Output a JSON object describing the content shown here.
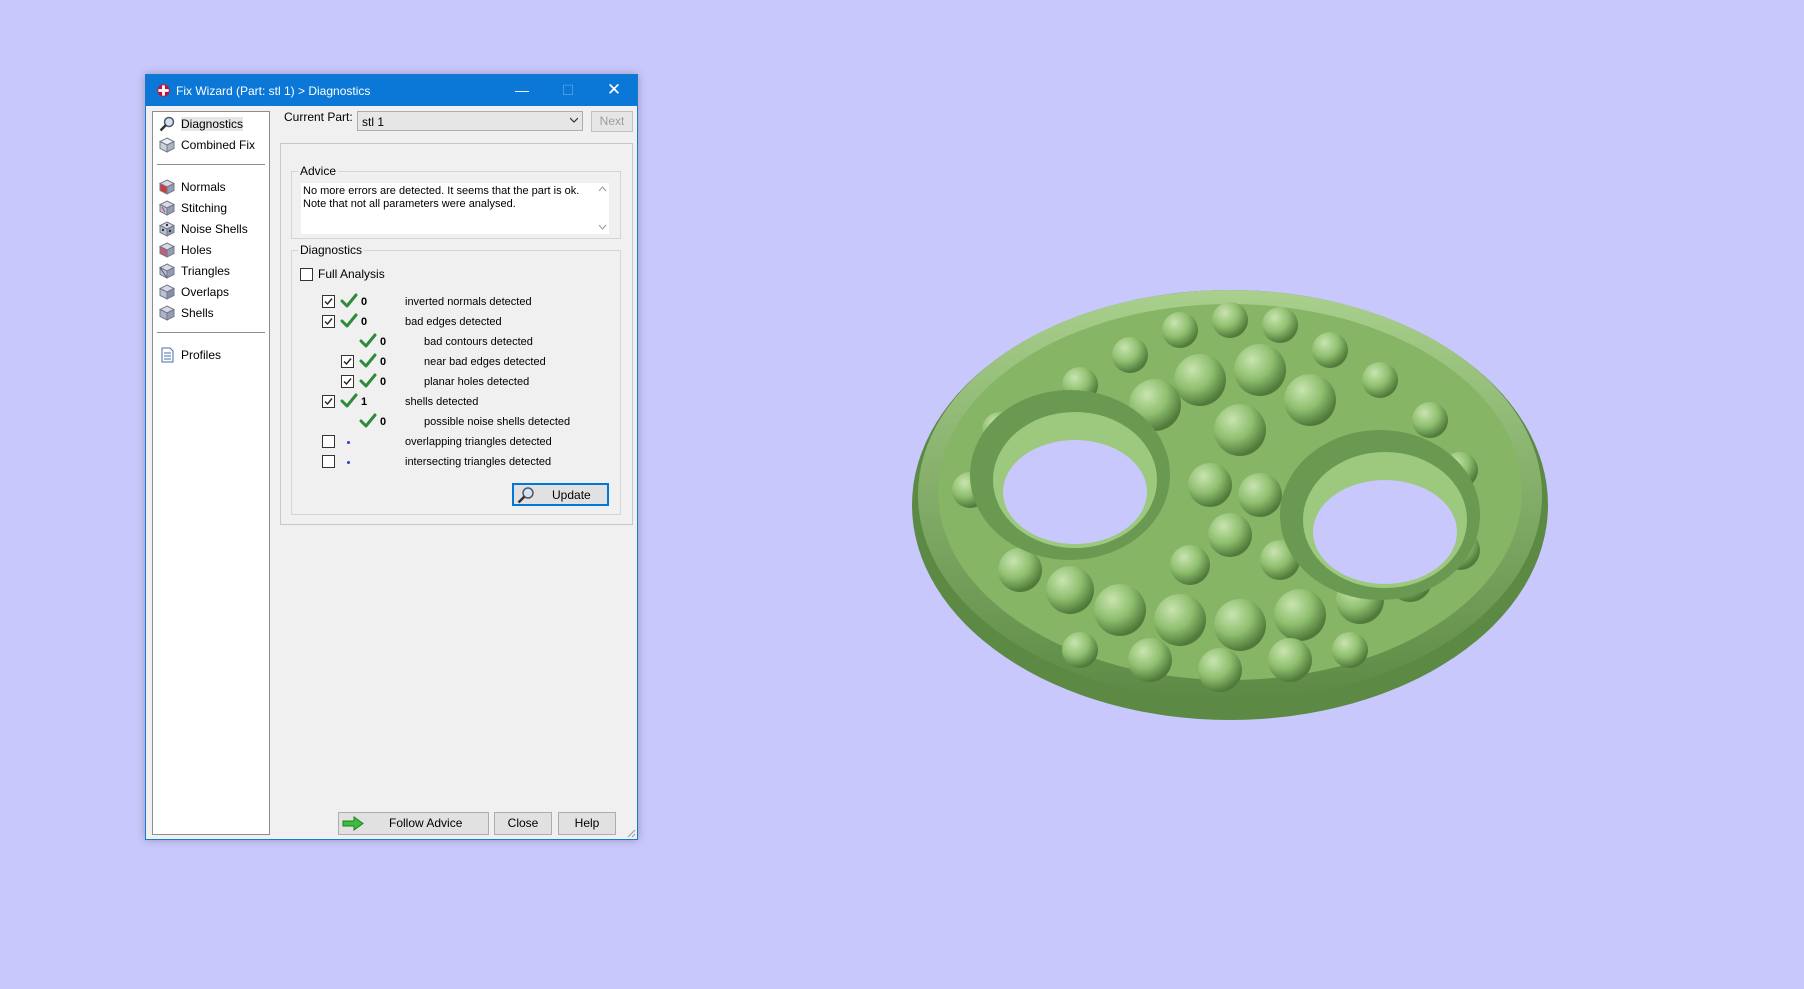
{
  "window": {
    "title": "Fix Wizard (Part: stl 1) > Diagnostics",
    "minimize_glyph": "—",
    "maximize_glyph": "☐",
    "close_glyph": "✕"
  },
  "sidebar": {
    "items": [
      {
        "label": "Diagnostics",
        "icon": "magnifier-icon",
        "selected": true
      },
      {
        "label": "Combined Fix",
        "icon": "cube-icon"
      },
      {
        "label": "Normals",
        "icon": "cube-red-icon"
      },
      {
        "label": "Stitching",
        "icon": "cube-stitch-icon"
      },
      {
        "label": "Noise Shells",
        "icon": "cube-noise-icon"
      },
      {
        "label": "Holes",
        "icon": "cube-holes-icon"
      },
      {
        "label": "Triangles",
        "icon": "cube-triangles-icon"
      },
      {
        "label": "Overlaps",
        "icon": "cube-overlaps-icon"
      },
      {
        "label": "Shells",
        "icon": "cube-shells-icon"
      },
      {
        "label": "Profiles",
        "icon": "document-icon"
      }
    ]
  },
  "header": {
    "current_part_label": "Current Part:",
    "current_part_value": "stl 1",
    "next_label": "Next"
  },
  "advice": {
    "label": "Advice",
    "line1": "No more errors are detected. It seems that the part is ok.",
    "line2": "Note that not all parameters were analysed."
  },
  "diagnostics": {
    "label": "Diagnostics",
    "full_analysis_label": "Full Analysis",
    "full_analysis_checked": false,
    "rows": [
      {
        "checkbox": true,
        "checked": true,
        "status": "ok",
        "value": "0",
        "text": "inverted normals detected",
        "indent": 0
      },
      {
        "checkbox": true,
        "checked": true,
        "status": "ok",
        "value": "0",
        "text": "bad edges detected",
        "indent": 0
      },
      {
        "checkbox": false,
        "checked": false,
        "status": "ok",
        "value": "0",
        "text": "bad contours detected",
        "indent": 1
      },
      {
        "checkbox": true,
        "checked": true,
        "status": "ok",
        "value": "0",
        "text": "near bad edges detected",
        "indent": 1
      },
      {
        "checkbox": true,
        "checked": true,
        "status": "ok",
        "value": "0",
        "text": "planar holes detected",
        "indent": 1
      },
      {
        "checkbox": true,
        "checked": true,
        "status": "ok",
        "value": "1",
        "text": "shells detected",
        "indent": 0
      },
      {
        "checkbox": false,
        "checked": false,
        "status": "ok",
        "value": "0",
        "text": "possible noise shells detected",
        "indent": 1
      },
      {
        "checkbox": true,
        "checked": false,
        "status": "pending",
        "value": "",
        "text": "overlapping triangles detected",
        "indent": 0
      },
      {
        "checkbox": true,
        "checked": false,
        "status": "pending",
        "value": "",
        "text": "intersecting triangles detected",
        "indent": 0
      }
    ],
    "update_label": "Update"
  },
  "footer": {
    "follow_advice_label": "Follow Advice",
    "close_label": "Close",
    "help_label": "Help"
  },
  "colors": {
    "desktop_bg": "#c8c8fc",
    "titlebar": "#0b78d7",
    "model_green": "#8fbf6f",
    "check_green": "#2e8b3a",
    "pending_dot": "#2b3bd6"
  }
}
